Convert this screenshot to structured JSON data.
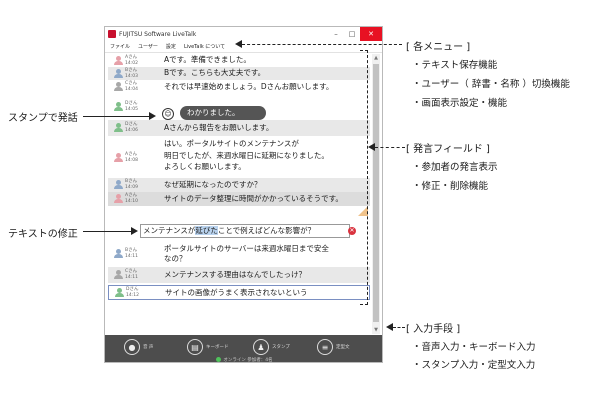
{
  "window": {
    "title": "FUJITSU Software LiveTalk",
    "menu": [
      "ファイル",
      "ユーザー",
      "設定",
      "LiveTalk について"
    ]
  },
  "messages": [
    {
      "speaker": "Aさん",
      "time": "14:02",
      "text": "Aです。準備できました。",
      "avatar": "a"
    },
    {
      "speaker": "Bさん",
      "time": "14:03",
      "text": "Bです。こちらも大丈夫です。",
      "avatar": "b"
    },
    {
      "speaker": "Cさん",
      "time": "14:04",
      "text": "それでは早速始めましょう。Dさんお願いします。",
      "avatar": "c"
    },
    {
      "speaker": "Dさん",
      "time": "14:06",
      "text": "Aさんから報告をお願いします。",
      "avatar": "d"
    },
    {
      "speaker": "Aさん",
      "time": "14:08",
      "text": "はい。ポータルサイトのメンテナンスが",
      "text2": "明日でしたが、来週水曜日に延期になりました。",
      "text3": "よろしくお願いします。",
      "avatar": "a"
    },
    {
      "speaker": "Bさん",
      "time": "14:09",
      "text": "なぜ延期になったのですか？",
      "avatar": "b"
    },
    {
      "speaker": "Aさん",
      "time": "14:10",
      "text": "サイトのデータ整理に時間がかかっているそうです。",
      "avatar": "a"
    },
    {
      "speaker": "Bさん",
      "time": "14:11",
      "text": "ポータルサイトのサーバーは来週水曜日まで安全",
      "text2": "なの？",
      "avatar": "b"
    },
    {
      "speaker": "Cさん",
      "time": "14:11",
      "text": "メンテナンスする理由はなんでしたっけ？",
      "avatar": "c"
    },
    {
      "speaker": "Dさん",
      "time": "14:12",
      "text": "サイトの画像がうまく表示されないという",
      "avatar": "d"
    }
  ],
  "stamp": {
    "speaker": "Dさん",
    "time": "14:05",
    "text": "わかりました。"
  },
  "edit": {
    "before": "メンテナンスが",
    "highlight": "延びた",
    "after": "ことで例えばどんな影響が？"
  },
  "input_bar": {
    "buttons": [
      "音 声",
      "キーボード",
      "スタンプ",
      "定型文"
    ],
    "status": "オンライン 参加者：4名"
  },
  "callouts": {
    "stamp_label": "スタンプで発話",
    "edit_label": "テキストの修正",
    "menu_heading": "[ 各メニュー ]",
    "menu_items": [
      "・テキスト保存機能",
      "・ユーザー（ 辞書・名称 ）切換機能",
      "・画面表示設定・機能"
    ],
    "field_heading": "[ 発言フィールド ]",
    "field_items": [
      "・参加者の発言表示",
      "・修正・削除機能"
    ],
    "input_heading": "[ 入力手段 ]",
    "input_items": [
      "・音声入力・キーボード入力",
      "・スタンプ入力・定型文入力"
    ]
  },
  "colors": {
    "avatar_a": "#e6a0a8",
    "avatar_b": "#8fa9c9",
    "avatar_c": "#a8a8a8",
    "avatar_d": "#7fbf8a",
    "close": "#e81123",
    "delete": "#d9333f"
  }
}
